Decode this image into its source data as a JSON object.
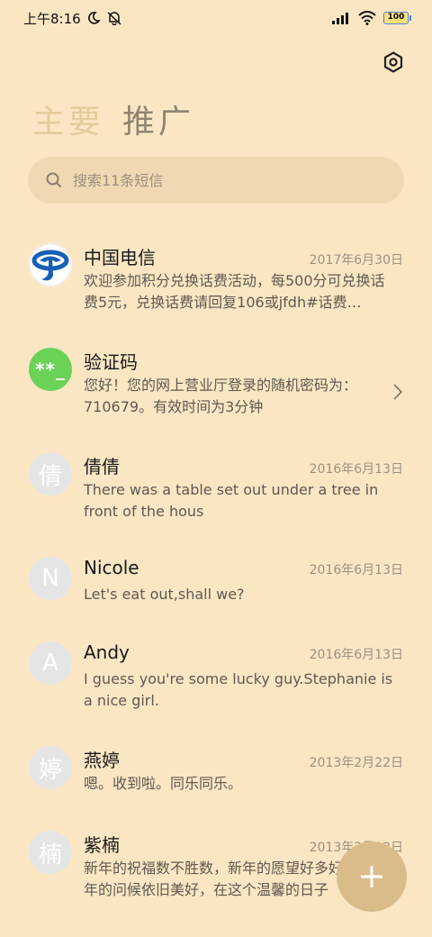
{
  "status_bar": {
    "time": "上午8:16",
    "battery": "100"
  },
  "tabs": [
    {
      "label": "主要"
    },
    {
      "label": "推广"
    }
  ],
  "search": {
    "placeholder": "搜索11条短信"
  },
  "messages": [
    {
      "name": "中国电信",
      "date": "2017年6月30日",
      "preview": "欢迎参加积分兑换话费活动，每500分可兑换话费5元，兑换话费请回复106或jfdh#话费…",
      "avatar": ""
    },
    {
      "name": "验证码",
      "date": "",
      "preview": "您好！您的网上营业厅登录的随机密码为：710679。有效时间为3分钟",
      "avatar": "**_"
    },
    {
      "name": "倩倩",
      "date": "2016年6月13日",
      "preview": "There was a table set out under a tree in front of the hous",
      "avatar": "倩"
    },
    {
      "name": "Nicole",
      "date": "2016年6月13日",
      "preview": "Let's eat out,shall we?",
      "avatar": "N"
    },
    {
      "name": "Andy",
      "date": "2016年6月13日",
      "preview": "I guess you're some lucky guy.Stephanie is a nice girl.",
      "avatar": "A"
    },
    {
      "name": "燕婷",
      "date": "2013年2月22日",
      "preview": "嗯。收到啦。同乐同乐。",
      "avatar": "婷"
    },
    {
      "name": "紫楠",
      "date": "2013年2月22日",
      "preview": "新年的祝福数不胜数，新年的愿望好多好多，新年的问候依旧美好，在这个温馨的日子",
      "avatar": "楠"
    }
  ],
  "colors": {
    "background": "#fbe6c4",
    "fab": "#d9bc8a",
    "search_bg": "#efd9b2"
  }
}
